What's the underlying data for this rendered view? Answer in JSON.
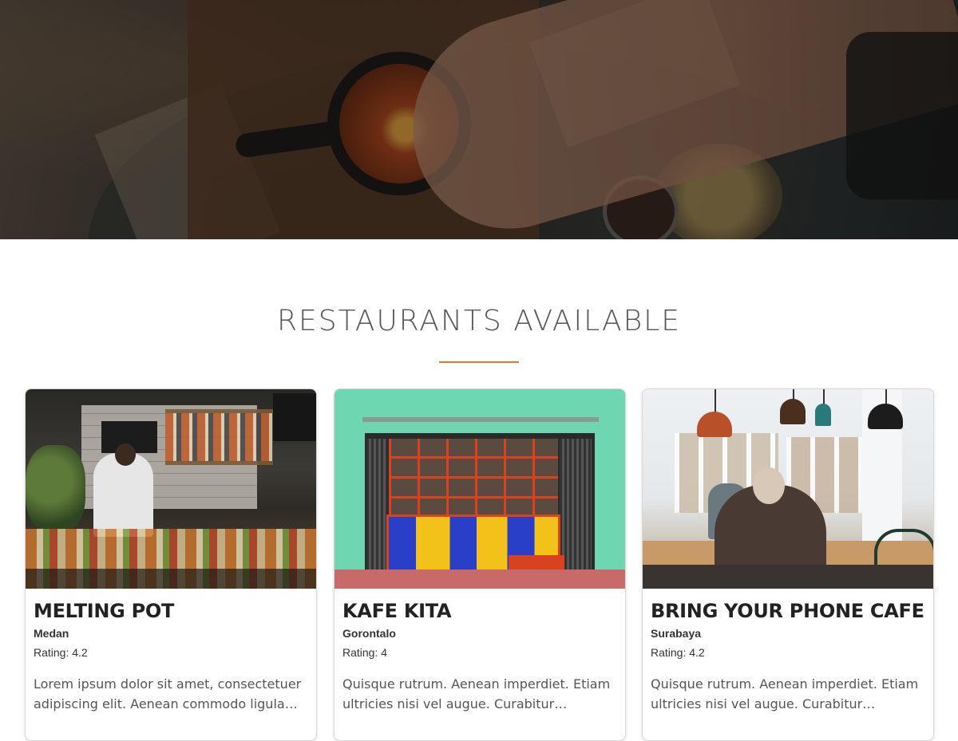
{
  "hero": {
    "image": "restaurant-table-food-photo"
  },
  "section": {
    "title": "RESTAURANTS AVAILABLE",
    "accent_color": "#e07a2e"
  },
  "restaurants": [
    {
      "name": "MELTING POT",
      "city": "Medan",
      "rating": "Rating: 4.2",
      "description": "Lorem ipsum dolor sit amet, consectetuer adipiscing elit. Aenean commodo ligula eget dolor.",
      "image": "kitchen-counter-photo"
    },
    {
      "name": "KAFE KITA",
      "city": "Gorontalo",
      "rating": "Rating: 4",
      "description": "Quisque rutrum. Aenean imperdiet. Etiam ultricies nisi vel augue. Curabitur ullamcorper ultricies nisi.",
      "image": "colorful-storefront-photo"
    },
    {
      "name": "BRING YOUR PHONE CAFE",
      "city": "Surabaya",
      "rating": "Rating: 4.2",
      "description": "Quisque rutrum. Aenean imperdiet. Etiam ultricies nisi vel augue. Curabitur ullamcorper ultricies nisi.",
      "image": "cafe-interior-photo"
    }
  ]
}
